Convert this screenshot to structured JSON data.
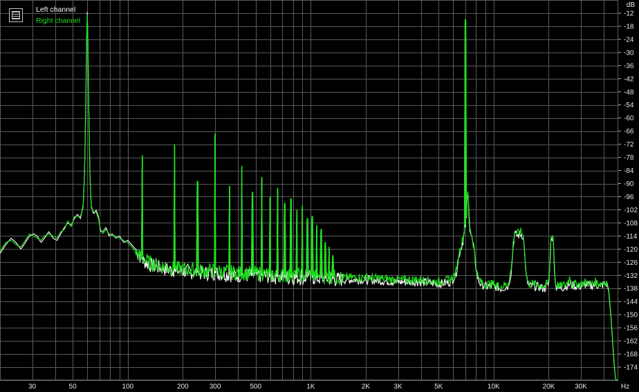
{
  "chart_data": {
    "type": "line",
    "title": "",
    "y_unit_label": "dB",
    "x_unit_label": "Hz",
    "x_scale": "log",
    "xlim": [
      20,
      48000
    ],
    "ylim": [
      -180,
      -6
    ],
    "grid": true,
    "legend_position": "top-left",
    "x_ticks": [
      {
        "v": 30,
        "label": "30"
      },
      {
        "v": 50,
        "label": "50"
      },
      {
        "v": 100,
        "label": "100"
      },
      {
        "v": 200,
        "label": "200"
      },
      {
        "v": 300,
        "label": "300"
      },
      {
        "v": 500,
        "label": "500"
      },
      {
        "v": 1000,
        "label": "1K"
      },
      {
        "v": 2000,
        "label": "2K"
      },
      {
        "v": 3000,
        "label": "3K"
      },
      {
        "v": 5000,
        "label": "5K"
      },
      {
        "v": 10000,
        "label": "10K"
      },
      {
        "v": 20000,
        "label": "20K"
      },
      {
        "v": 30000,
        "label": "30K"
      }
    ],
    "y_ticks": [
      -12,
      -18,
      -24,
      -30,
      -36,
      -42,
      -48,
      -54,
      -60,
      -66,
      -72,
      -78,
      -84,
      -90,
      -96,
      -102,
      -108,
      -114,
      -120,
      -126,
      -132,
      -138,
      -144,
      -150,
      -156,
      -162,
      -168,
      -174
    ],
    "series": [
      {
        "name": "Left channel",
        "color": "#ffffff",
        "points": [
          [
            20,
            -122
          ],
          [
            21.5,
            -118
          ],
          [
            23,
            -115
          ],
          [
            24.5,
            -117
          ],
          [
            26,
            -120
          ],
          [
            27.5,
            -117
          ],
          [
            29,
            -114
          ],
          [
            30.5,
            -113
          ],
          [
            32,
            -114
          ],
          [
            33.5,
            -117
          ],
          [
            35,
            -115
          ],
          [
            37,
            -112
          ],
          [
            39,
            -115
          ],
          [
            41,
            -116
          ],
          [
            43,
            -113
          ],
          [
            45,
            -110
          ],
          [
            47,
            -108
          ],
          [
            49,
            -109
          ],
          [
            51,
            -106
          ],
          [
            53,
            -104
          ],
          [
            55,
            -106
          ],
          [
            57,
            -100
          ],
          [
            58,
            -85
          ],
          [
            59,
            -50
          ],
          [
            59.5,
            -25
          ],
          [
            60,
            -11
          ],
          [
            60.5,
            -25
          ],
          [
            61,
            -50
          ],
          [
            62,
            -85
          ],
          [
            63,
            -100
          ],
          [
            65,
            -104
          ],
          [
            67,
            -102
          ],
          [
            69,
            -105
          ],
          [
            71,
            -112
          ],
          [
            73,
            -112
          ],
          [
            76,
            -110
          ],
          [
            79,
            -114
          ],
          [
            82,
            -113
          ],
          [
            86,
            -115
          ],
          [
            90,
            -114
          ],
          [
            95,
            -117
          ],
          [
            100,
            -116
          ],
          [
            105,
            -118
          ],
          [
            110,
            -120
          ],
          [
            115,
            -122
          ],
          [
            120,
            -125
          ],
          [
            130,
            -127
          ],
          [
            140,
            -128
          ],
          [
            160,
            -129
          ],
          [
            180,
            -130
          ],
          [
            200,
            -130
          ],
          [
            250,
            -131
          ],
          [
            300,
            -131
          ],
          [
            400,
            -132
          ],
          [
            500,
            -132
          ],
          [
            700,
            -133
          ],
          [
            1000,
            -133
          ],
          [
            1500,
            -134
          ],
          [
            2000,
            -134
          ],
          [
            3000,
            -135
          ],
          [
            4000,
            -135
          ],
          [
            5000,
            -136
          ],
          [
            5800,
            -135
          ],
          [
            6200,
            -132
          ],
          [
            6500,
            -122
          ],
          [
            6800,
            -116
          ],
          [
            7000,
            -110
          ],
          [
            7100,
            -105
          ],
          [
            7200,
            -94
          ],
          [
            7300,
            -100
          ],
          [
            7400,
            -110
          ],
          [
            7600,
            -115
          ],
          [
            7800,
            -120
          ],
          [
            8000,
            -128
          ],
          [
            8200,
            -134
          ],
          [
            8500,
            -136
          ],
          [
            9000,
            -137
          ],
          [
            10000,
            -137
          ],
          [
            11000,
            -138
          ],
          [
            12000,
            -137
          ],
          [
            12500,
            -130
          ],
          [
            12800,
            -118
          ],
          [
            13000,
            -113
          ],
          [
            13500,
            -114
          ],
          [
            14000,
            -113
          ],
          [
            14500,
            -114
          ],
          [
            14800,
            -122
          ],
          [
            15000,
            -132
          ],
          [
            15500,
            -137
          ],
          [
            17000,
            -137
          ],
          [
            19000,
            -138
          ],
          [
            20000,
            -136
          ],
          [
            20300,
            -128
          ],
          [
            20500,
            -116
          ],
          [
            20800,
            -114
          ],
          [
            21200,
            -116
          ],
          [
            21500,
            -128
          ],
          [
            21800,
            -137
          ],
          [
            23000,
            -138
          ],
          [
            25000,
            -137
          ],
          [
            26000,
            -136
          ],
          [
            28000,
            -137
          ],
          [
            30000,
            -137
          ],
          [
            32000,
            -136
          ],
          [
            34000,
            -137
          ],
          [
            36000,
            -136
          ],
          [
            38000,
            -137
          ],
          [
            40000,
            -136
          ],
          [
            41500,
            -136
          ],
          [
            42500,
            -139
          ],
          [
            43500,
            -148
          ],
          [
            44500,
            -160
          ],
          [
            45500,
            -172
          ],
          [
            46500,
            -180
          ]
        ],
        "spikes": [
          {
            "x": 120,
            "y": -78
          },
          {
            "x": 180,
            "y": -73
          },
          {
            "x": 240,
            "y": -90
          },
          {
            "x": 300,
            "y": -68
          },
          {
            "x": 360,
            "y": -92
          },
          {
            "x": 420,
            "y": -83
          },
          {
            "x": 480,
            "y": -95
          },
          {
            "x": 540,
            "y": -88
          },
          {
            "x": 600,
            "y": -97
          },
          {
            "x": 660,
            "y": -93
          },
          {
            "x": 720,
            "y": -100
          },
          {
            "x": 780,
            "y": -98
          },
          {
            "x": 840,
            "y": -103
          },
          {
            "x": 900,
            "y": -101
          },
          {
            "x": 960,
            "y": -107
          },
          {
            "x": 1020,
            "y": -106
          },
          {
            "x": 1080,
            "y": -110
          },
          {
            "x": 1140,
            "y": -112
          },
          {
            "x": 1200,
            "y": -118
          },
          {
            "x": 1260,
            "y": -120
          },
          {
            "x": 1320,
            "y": -124
          },
          {
            "x": 7000,
            "y": -16
          }
        ]
      },
      {
        "name": "Right channel",
        "color": "#19e119",
        "points": [
          [
            20,
            -121
          ],
          [
            21.5,
            -117
          ],
          [
            23,
            -116
          ],
          [
            24.5,
            -118
          ],
          [
            26,
            -119
          ],
          [
            27.5,
            -116
          ],
          [
            29,
            -113
          ],
          [
            30.5,
            -114
          ],
          [
            32,
            -115
          ],
          [
            33.5,
            -116
          ],
          [
            35,
            -114
          ],
          [
            37,
            -113
          ],
          [
            39,
            -114
          ],
          [
            41,
            -115
          ],
          [
            43,
            -112
          ],
          [
            45,
            -111
          ],
          [
            47,
            -107
          ],
          [
            49,
            -110
          ],
          [
            51,
            -105
          ],
          [
            53,
            -105
          ],
          [
            55,
            -105
          ],
          [
            57,
            -101
          ],
          [
            58,
            -84
          ],
          [
            59,
            -48
          ],
          [
            59.5,
            -24
          ],
          [
            60,
            -12
          ],
          [
            60.5,
            -24
          ],
          [
            61,
            -48
          ],
          [
            62,
            -84
          ],
          [
            63,
            -101
          ],
          [
            65,
            -103
          ],
          [
            67,
            -103
          ],
          [
            69,
            -106
          ],
          [
            71,
            -111
          ],
          [
            73,
            -113
          ],
          [
            76,
            -111
          ],
          [
            79,
            -113
          ],
          [
            82,
            -114
          ],
          [
            86,
            -114
          ],
          [
            90,
            -115
          ],
          [
            95,
            -116
          ],
          [
            100,
            -117
          ],
          [
            105,
            -119
          ],
          [
            110,
            -121
          ],
          [
            115,
            -123
          ],
          [
            120,
            -124
          ],
          [
            130,
            -126
          ],
          [
            140,
            -127
          ],
          [
            160,
            -128
          ],
          [
            180,
            -129
          ],
          [
            200,
            -129
          ],
          [
            250,
            -130
          ],
          [
            300,
            -130
          ],
          [
            400,
            -131
          ],
          [
            500,
            -131
          ],
          [
            700,
            -132
          ],
          [
            1000,
            -132
          ],
          [
            1500,
            -133
          ],
          [
            2000,
            -133
          ],
          [
            3000,
            -134
          ],
          [
            4000,
            -134
          ],
          [
            5000,
            -135
          ],
          [
            5800,
            -134
          ],
          [
            6200,
            -131
          ],
          [
            6500,
            -121
          ],
          [
            6800,
            -115
          ],
          [
            7000,
            -109
          ],
          [
            7100,
            -104
          ],
          [
            7200,
            -93
          ],
          [
            7300,
            -99
          ],
          [
            7400,
            -109
          ],
          [
            7600,
            -114
          ],
          [
            7800,
            -119
          ],
          [
            8000,
            -127
          ],
          [
            8200,
            -133
          ],
          [
            8500,
            -135
          ],
          [
            9000,
            -136
          ],
          [
            10000,
            -136
          ],
          [
            11000,
            -137
          ],
          [
            12000,
            -136
          ],
          [
            12500,
            -129
          ],
          [
            12800,
            -117
          ],
          [
            13000,
            -112
          ],
          [
            13500,
            -113
          ],
          [
            14000,
            -112
          ],
          [
            14500,
            -113
          ],
          [
            14800,
            -121
          ],
          [
            15000,
            -131
          ],
          [
            15500,
            -136
          ],
          [
            17000,
            -136
          ],
          [
            19000,
            -137
          ],
          [
            20000,
            -135
          ],
          [
            20300,
            -127
          ],
          [
            20500,
            -115
          ],
          [
            20800,
            -113
          ],
          [
            21200,
            -115
          ],
          [
            21500,
            -127
          ],
          [
            21800,
            -136
          ],
          [
            23000,
            -137
          ],
          [
            25000,
            -136
          ],
          [
            26000,
            -133
          ],
          [
            27000,
            -136
          ],
          [
            28000,
            -136
          ],
          [
            30000,
            -136
          ],
          [
            32000,
            -135
          ],
          [
            34000,
            -136
          ],
          [
            36000,
            -135
          ],
          [
            38000,
            -136
          ],
          [
            40000,
            -135
          ],
          [
            41500,
            -135
          ],
          [
            42500,
            -138
          ],
          [
            43500,
            -147
          ],
          [
            44500,
            -159
          ],
          [
            45500,
            -171
          ],
          [
            46500,
            -180
          ]
        ],
        "spikes": [
          {
            "x": 120,
            "y": -77
          },
          {
            "x": 180,
            "y": -72
          },
          {
            "x": 240,
            "y": -89
          },
          {
            "x": 300,
            "y": -67
          },
          {
            "x": 360,
            "y": -91
          },
          {
            "x": 420,
            "y": -82
          },
          {
            "x": 480,
            "y": -94
          },
          {
            "x": 540,
            "y": -87
          },
          {
            "x": 600,
            "y": -96
          },
          {
            "x": 660,
            "y": -92
          },
          {
            "x": 720,
            "y": -99
          },
          {
            "x": 780,
            "y": -97
          },
          {
            "x": 840,
            "y": -102
          },
          {
            "x": 900,
            "y": -100
          },
          {
            "x": 960,
            "y": -106
          },
          {
            "x": 1020,
            "y": -105
          },
          {
            "x": 1080,
            "y": -109
          },
          {
            "x": 1140,
            "y": -111
          },
          {
            "x": 1200,
            "y": -117
          },
          {
            "x": 1260,
            "y": -119
          },
          {
            "x": 1320,
            "y": -123
          },
          {
            "x": 7000,
            "y": -15
          }
        ]
      }
    ]
  },
  "legend": {
    "left_label": "Left channel",
    "right_label": "Right channel"
  }
}
